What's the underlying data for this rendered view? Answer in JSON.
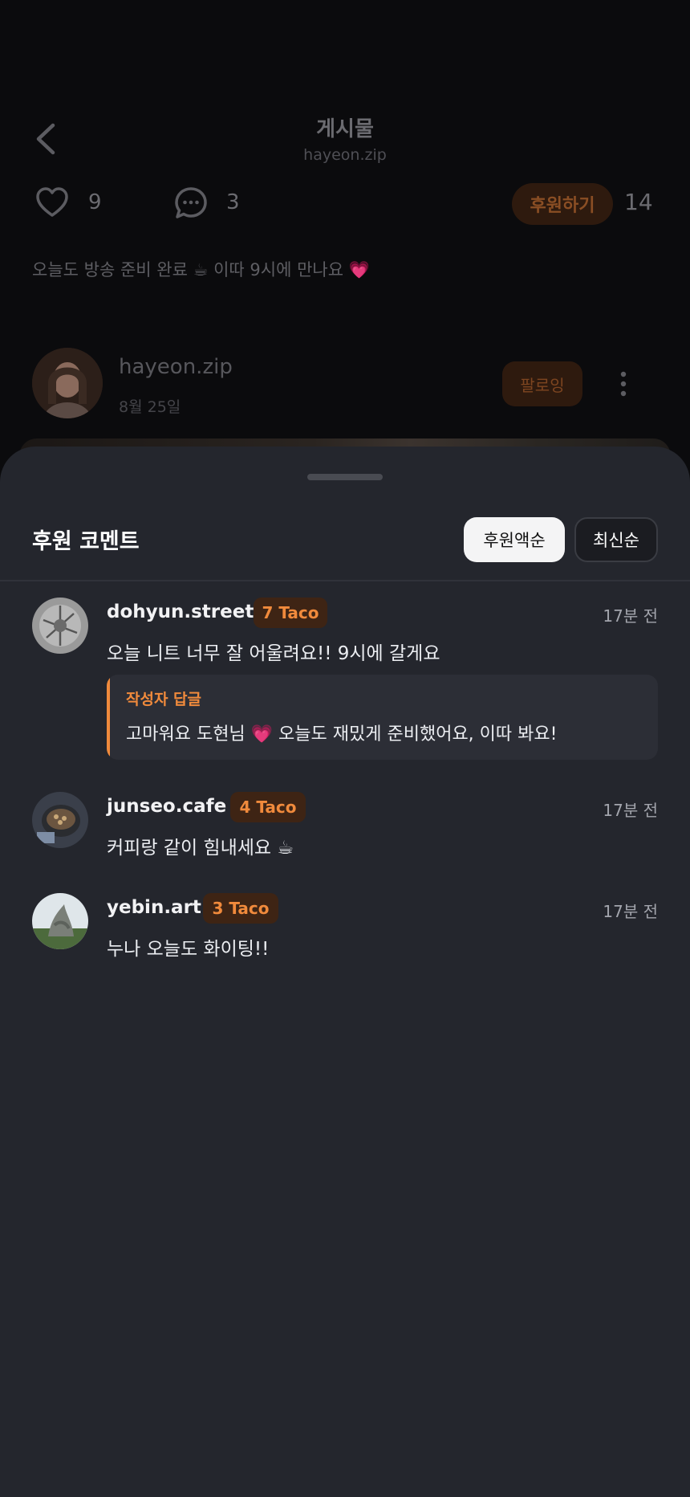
{
  "header": {
    "title": "게시물",
    "subtitle": "hayeon.zip"
  },
  "post": {
    "like_count": "9",
    "comment_count": "3",
    "donate_label": "후원하기",
    "donate_count": "14",
    "caption": "오늘도 방송 준비 완료 ☕ 이따 9시에 만나요 💗",
    "author": {
      "name": "hayeon.zip",
      "date": "8월 25일",
      "follow_label": "팔로잉"
    }
  },
  "sheet": {
    "title": "후원 코멘트",
    "sort_options": [
      "후원액순",
      "최신순"
    ],
    "active_sort": "후원액순",
    "comments": [
      {
        "username": "dohyun.street",
        "badge": "7 Taco",
        "time": "17분 전",
        "text": "오늘 니트 너무 잘 어울려요!! 9시에 갈게요",
        "reply": {
          "label": "작성자 답글",
          "text": "고마워요 도현님 💗  오늘도 재밌게 준비했어요, 이따 봐요!"
        }
      },
      {
        "username": "junseo.cafe",
        "badge": "4 Taco",
        "time": "17분 전",
        "text": "커피랑 같이 힘내세요 ☕"
      },
      {
        "username": "yebin.art",
        "badge": "3 Taco",
        "time": "17분 전",
        "text": "누나 오늘도 화이팅!!"
      }
    ]
  },
  "colors": {
    "accent": "#f08a3c",
    "sheet_bg": "#24262d",
    "backdrop": "#0b0b0d"
  }
}
